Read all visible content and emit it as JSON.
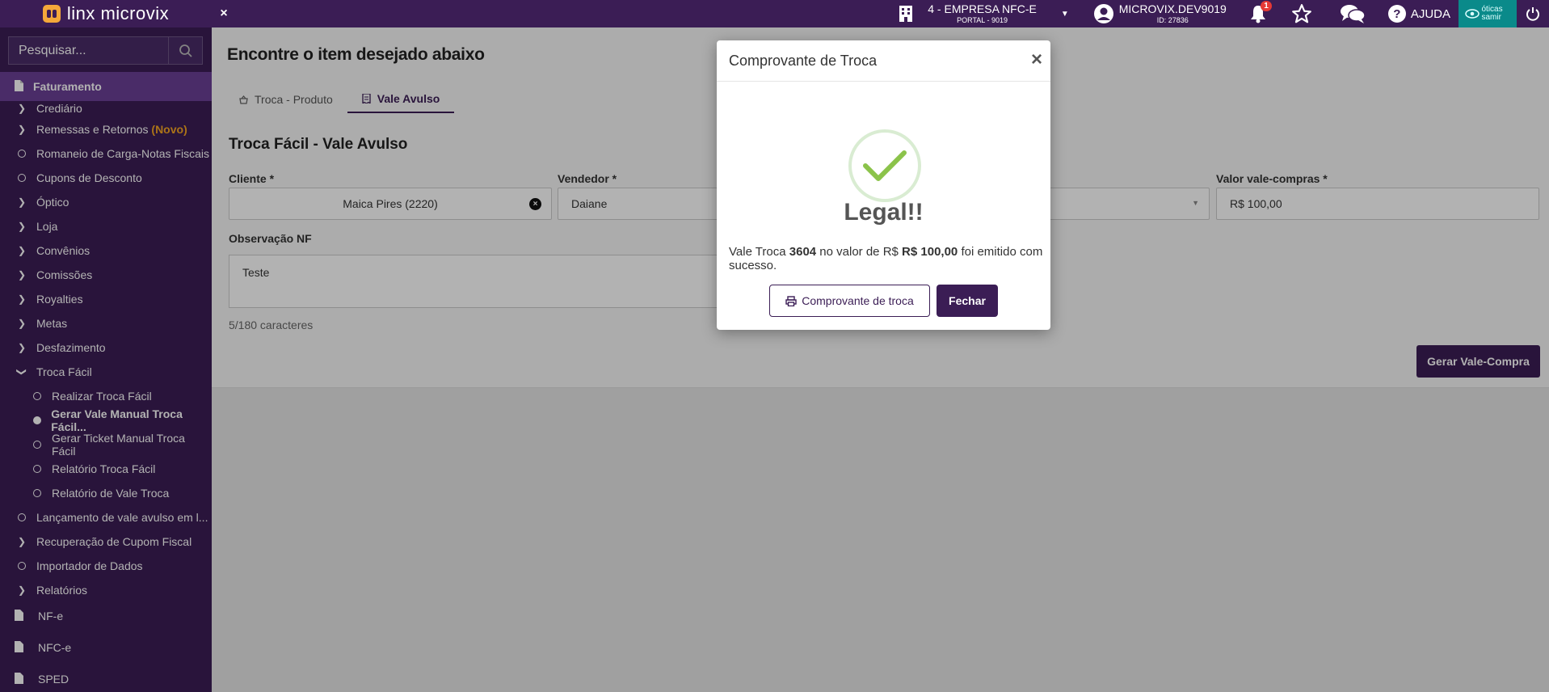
{
  "colors": {
    "brand": "#3b1d55",
    "sidebar_active": "#6a3f95",
    "accent_orange": "#f6a623",
    "success_green": "#8bc34a",
    "badge_red": "#e53935",
    "partner_teal": "#0a8a8a"
  },
  "topbar": {
    "logo_text": "linx microvix",
    "logo_icon": "linx-logo-icon",
    "close_toggle": "×",
    "company_name": "4 - EMPRESA NFC-E",
    "company_portal": "PORTAL - 9019",
    "user_name": "MICROVIX.DEV9019",
    "user_id": "ID: 27836",
    "notifications_count": "1",
    "help_label": "AJUDA",
    "partner_label": "óticas samir"
  },
  "sidebar": {
    "search_placeholder": "Pesquisar...",
    "section_title": "Faturamento",
    "items": [
      {
        "label": "Crediário",
        "icon": "chevron-right-icon"
      },
      {
        "label": "Remessas e Retornos",
        "suffix": "(Novo)",
        "icon": "chevron-right-icon"
      },
      {
        "label": "Romaneio de Carga-Notas Fiscais",
        "icon": "circle-icon"
      },
      {
        "label": "Cupons de Desconto",
        "icon": "circle-icon"
      },
      {
        "label": "Óptico",
        "icon": "chevron-right-icon"
      },
      {
        "label": "Loja",
        "icon": "chevron-right-icon"
      },
      {
        "label": "Convênios",
        "icon": "chevron-right-icon"
      },
      {
        "label": "Comissões",
        "icon": "chevron-right-icon"
      },
      {
        "label": "Royalties",
        "icon": "chevron-right-icon"
      },
      {
        "label": "Metas",
        "icon": "chevron-right-icon"
      },
      {
        "label": "Desfazimento",
        "icon": "chevron-right-icon"
      },
      {
        "label": "Troca Fácil",
        "icon": "chevron-down-icon"
      },
      {
        "label": "Realizar Troca Fácil",
        "icon": "circle-icon"
      },
      {
        "label": "Gerar Vale Manual Troca Fácil...",
        "icon": "filled-circle-icon"
      },
      {
        "label": "Gerar Ticket Manual Troca Fácil",
        "icon": "circle-icon"
      },
      {
        "label": "Relatório Troca Fácil",
        "icon": "circle-icon"
      },
      {
        "label": "Relatório de Vale Troca",
        "icon": "circle-icon"
      },
      {
        "label": "Lançamento de vale avulso em l...",
        "icon": "circle-icon"
      },
      {
        "label": "Recuperação de Cupom Fiscal",
        "icon": "chevron-right-icon"
      },
      {
        "label": "Importador de Dados",
        "icon": "circle-icon"
      },
      {
        "label": "Relatórios",
        "icon": "chevron-right-icon"
      }
    ],
    "doc_items": [
      {
        "label": "NF-e"
      },
      {
        "label": "NFC-e"
      },
      {
        "label": "SPED"
      }
    ]
  },
  "main": {
    "page_title": "Encontre o item desejado abaixo",
    "tabs": [
      {
        "label": "Troca - Produto"
      },
      {
        "label": "Vale Avulso"
      }
    ],
    "form_title": "Troca Fácil - Vale Avulso",
    "fields": {
      "cliente_label": "Cliente *",
      "cliente_value": "Maica Pires (2220)",
      "vendedor_label": "Vendedor *",
      "vendedor_value": "Daiane",
      "valor_label": "Valor vale-compras *",
      "valor_value": "R$ 100,00",
      "obs_label": "Observação NF",
      "obs_value": "Teste",
      "counter": "5/180 caracteres"
    },
    "generate_button": "Gerar Vale-Compra"
  },
  "modal": {
    "title": "Comprovante de Troca",
    "close": "×",
    "headline": "Legal!!",
    "msg_prefix": "Vale Troca ",
    "voucher_number": "3604",
    "msg_middle": " no valor de R$ ",
    "amount": "R$ 100,00",
    "msg_suffix": " foi emitido com sucesso.",
    "receipt_button": "Comprovante de troca",
    "close_button": "Fechar"
  }
}
